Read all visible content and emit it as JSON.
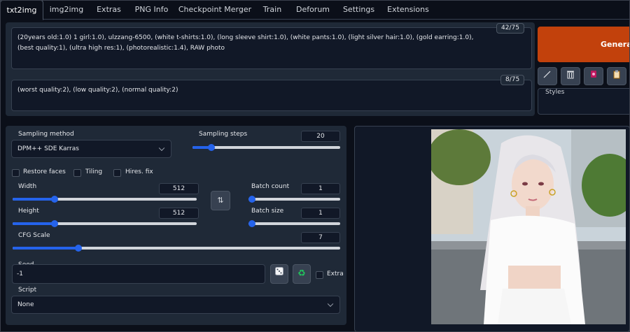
{
  "tabs": [
    "txt2img",
    "img2img",
    "Extras",
    "PNG Info",
    "Checkpoint Merger",
    "Train",
    "Deforum",
    "Settings",
    "Extensions"
  ],
  "prompt": {
    "positive_line1": "(20years old:1.0) 1 girl:1.0), ulzzang-6500, (white t-shirts:1.0), (long sleeve shirt:1.0), (white pants:1.0), (light silver hair:1.0), (gold earring:1.0),",
    "positive_line2": "(best quality:1), (ultra high res:1), (photorealistic:1.4), RAW photo",
    "positive_tokens": "42/75",
    "negative": "(worst quality:2), (low quality:2), (normal quality:2)",
    "negative_tokens": "8/75"
  },
  "generate_label": "Generat",
  "tools": [
    "pencil-icon",
    "trash-icon",
    "card-icon",
    "clipboard-icon"
  ],
  "styles_label": "Styles",
  "settings": {
    "sampling_method_label": "Sampling method",
    "sampling_method_value": "DPM++ SDE Karras",
    "sampling_steps_label": "Sampling steps",
    "sampling_steps_value": "20",
    "sampling_steps_fraction": 0.13,
    "restore_faces": "Restore faces",
    "tiling": "Tiling",
    "hires_fix": "Hires. fix",
    "width_label": "Width",
    "width_value": "512",
    "width_fraction": 0.23,
    "height_label": "Height",
    "height_value": "512",
    "height_fraction": 0.23,
    "batch_count_label": "Batch count",
    "batch_count_value": "1",
    "batch_count_fraction": 0.0,
    "batch_size_label": "Batch size",
    "batch_size_value": "1",
    "batch_size_fraction": 0.0,
    "cfg_label": "CFG Scale",
    "cfg_value": "7",
    "cfg_fraction": 0.2,
    "seed_label": "Seed",
    "seed_value": "-1",
    "extra_label": "Extra",
    "script_label": "Script",
    "script_value": "None"
  },
  "colors": {
    "generate": "#c2410c",
    "slider": "#2563eb"
  }
}
